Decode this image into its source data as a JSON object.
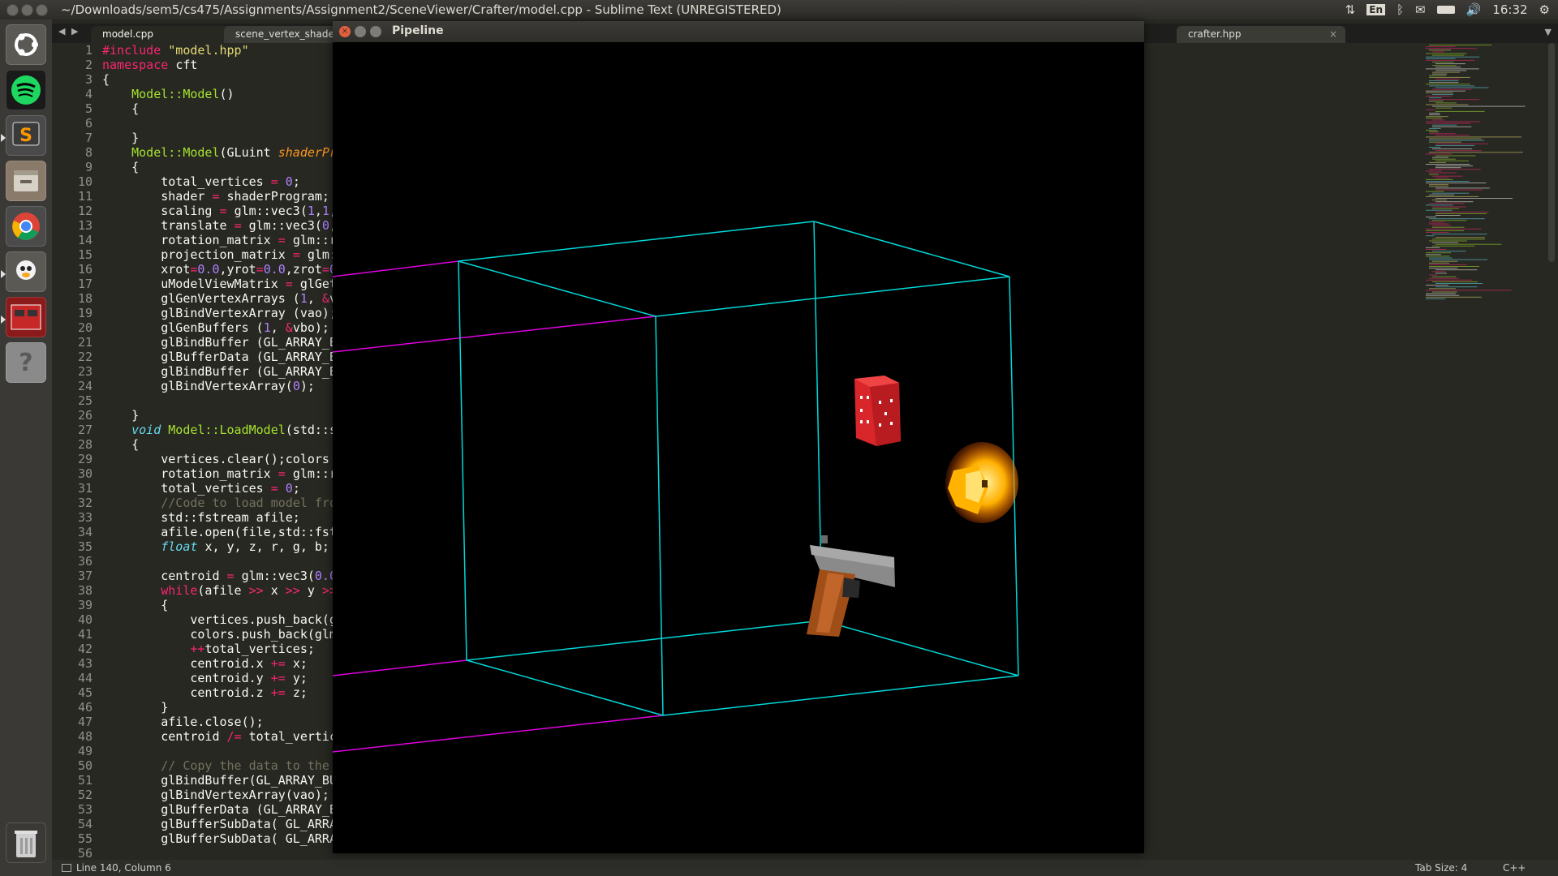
{
  "window": {
    "title": "~/Downloads/sem5/cs475/Assignments/Assignment2/SceneViewer/Crafter/model.cpp - Sublime Text (UNREGISTERED)"
  },
  "indicators": {
    "keyboard": "En",
    "clock": "16:32"
  },
  "launcher": {
    "apps": [
      {
        "name": "ubuntu-logo-icon"
      },
      {
        "name": "spotify-icon"
      },
      {
        "name": "sublime-text-icon"
      },
      {
        "name": "files-icon"
      },
      {
        "name": "chrome-icon"
      },
      {
        "name": "system-icon"
      },
      {
        "name": "pipeline-app-icon"
      },
      {
        "name": "unknown-app-icon"
      },
      {
        "name": "trash-icon"
      }
    ]
  },
  "tabs": [
    {
      "label": "model.cpp",
      "active": true
    },
    {
      "label": "scene_vertex_shader",
      "active": false
    },
    {
      "label": "crafter.hpp",
      "active": false
    }
  ],
  "editor": {
    "lines": [
      [
        [
          "kw",
          "#include "
        ],
        [
          "st",
          "\"model.hpp\""
        ]
      ],
      [
        [
          "kw",
          "namespace "
        ],
        [
          "",
          "cft"
        ]
      ],
      [
        [
          "",
          "{"
        ]
      ],
      [
        [
          "",
          "    "
        ],
        [
          "fn",
          "Model::Model"
        ],
        [
          "",
          "()"
        ]
      ],
      [
        [
          "",
          "    {"
        ]
      ],
      [
        [
          "",
          ""
        ]
      ],
      [
        [
          "",
          "    }"
        ]
      ],
      [
        [
          "",
          "    "
        ],
        [
          "fn",
          "Model::Model"
        ],
        [
          "",
          "(GLuint "
        ],
        [
          "pa",
          "shaderPr"
        ]
      ],
      [
        [
          "",
          "    {"
        ]
      ],
      [
        [
          "",
          "        total_vertices "
        ],
        [
          "kw",
          "= "
        ],
        [
          "nu",
          "0"
        ],
        [
          "",
          ";"
        ]
      ],
      [
        [
          "",
          "        shader "
        ],
        [
          "kw",
          "= "
        ],
        [
          "",
          "shaderProgram;"
        ]
      ],
      [
        [
          "",
          "        scaling "
        ],
        [
          "kw",
          "= "
        ],
        [
          "",
          "glm::vec3("
        ],
        [
          "nu",
          "1"
        ],
        [
          "",
          ","
        ],
        [
          "nu",
          "1"
        ],
        [
          "",
          ","
        ]
      ],
      [
        [
          "",
          "        translate "
        ],
        [
          "kw",
          "= "
        ],
        [
          "",
          "glm::vec3("
        ],
        [
          "nu",
          "0"
        ],
        [
          "",
          ","
        ]
      ],
      [
        [
          "",
          "        rotation_matrix "
        ],
        [
          "kw",
          "= "
        ],
        [
          "",
          "glm::r"
        ]
      ],
      [
        [
          "",
          "        projection_matrix "
        ],
        [
          "kw",
          "= "
        ],
        [
          "",
          "glm:"
        ]
      ],
      [
        [
          "",
          "        xrot"
        ],
        [
          "kw",
          "="
        ],
        [
          "nu",
          "0.0"
        ],
        [
          "",
          ",yrot"
        ],
        [
          "kw",
          "="
        ],
        [
          "nu",
          "0.0"
        ],
        [
          "",
          ",zrot"
        ],
        [
          "kw",
          "="
        ],
        [
          "nu",
          "0"
        ]
      ],
      [
        [
          "",
          "        uModelViewMatrix "
        ],
        [
          "kw",
          "= "
        ],
        [
          "",
          "glGet"
        ]
      ],
      [
        [
          "",
          "        glGenVertexArrays ("
        ],
        [
          "nu",
          "1"
        ],
        [
          "",
          ", "
        ],
        [
          "kw",
          "&"
        ],
        [
          "",
          "v"
        ]
      ],
      [
        [
          "",
          "        glBindVertexArray (vao);"
        ]
      ],
      [
        [
          "",
          "        glGenBuffers ("
        ],
        [
          "nu",
          "1"
        ],
        [
          "",
          ", "
        ],
        [
          "kw",
          "&"
        ],
        [
          "",
          "vbo);"
        ]
      ],
      [
        [
          "",
          "        glBindBuffer (GL_ARRAY_B"
        ]
      ],
      [
        [
          "",
          "        glBufferData (GL_ARRAY_B"
        ]
      ],
      [
        [
          "",
          "        glBindBuffer (GL_ARRAY_B"
        ]
      ],
      [
        [
          "",
          "        glBindVertexArray("
        ],
        [
          "nu",
          "0"
        ],
        [
          "",
          ");"
        ]
      ],
      [
        [
          "",
          ""
        ]
      ],
      [
        [
          "",
          "    }"
        ]
      ],
      [
        [
          "",
          "    "
        ],
        [
          "ty",
          "void "
        ],
        [
          "fn",
          "Model::LoadModel"
        ],
        [
          "",
          "(std::s"
        ]
      ],
      [
        [
          "",
          "    {"
        ]
      ],
      [
        [
          "",
          "        vertices.clear();colors"
        ]
      ],
      [
        [
          "",
          "        rotation_matrix "
        ],
        [
          "kw",
          "= "
        ],
        [
          "",
          "glm::r"
        ]
      ],
      [
        [
          "",
          "        total_vertices "
        ],
        [
          "kw",
          "= "
        ],
        [
          "nu",
          "0"
        ],
        [
          "",
          ";"
        ]
      ],
      [
        [
          "cm",
          "        //Code to load model fro"
        ]
      ],
      [
        [
          "",
          "        std::fstream afile;"
        ]
      ],
      [
        [
          "",
          "        afile.open(file,std::fst"
        ]
      ],
      [
        [
          "",
          "        "
        ],
        [
          "ty",
          "float "
        ],
        [
          "",
          "x, y, z, r, g, b;"
        ]
      ],
      [
        [
          "",
          ""
        ]
      ],
      [
        [
          "",
          "        centroid "
        ],
        [
          "kw",
          "= "
        ],
        [
          "",
          "glm::vec3("
        ],
        [
          "nu",
          "0.0"
        ]
      ],
      [
        [
          "",
          "        "
        ],
        [
          "kw",
          "while"
        ],
        [
          "",
          "(afile "
        ],
        [
          "kw",
          ">> "
        ],
        [
          "",
          "x "
        ],
        [
          "kw",
          ">> "
        ],
        [
          "",
          "y "
        ],
        [
          "kw",
          ">>"
        ]
      ],
      [
        [
          "",
          "        {"
        ]
      ],
      [
        [
          "",
          "            vertices.push_back(g"
        ]
      ],
      [
        [
          "",
          "            colors.push_back(glm"
        ]
      ],
      [
        [
          "",
          "            "
        ],
        [
          "kw",
          "++"
        ],
        [
          "",
          "total_vertices;"
        ]
      ],
      [
        [
          "",
          "            centroid.x "
        ],
        [
          "kw",
          "+= "
        ],
        [
          "",
          "x;"
        ]
      ],
      [
        [
          "",
          "            centroid.y "
        ],
        [
          "kw",
          "+= "
        ],
        [
          "",
          "y;"
        ]
      ],
      [
        [
          "",
          "            centroid.z "
        ],
        [
          "kw",
          "+= "
        ],
        [
          "",
          "z;"
        ]
      ],
      [
        [
          "",
          "        }"
        ]
      ],
      [
        [
          "",
          "        afile.close();"
        ]
      ],
      [
        [
          "",
          "        centroid "
        ],
        [
          "kw",
          "/= "
        ],
        [
          "",
          "total_vertic"
        ]
      ],
      [
        [
          "",
          ""
        ]
      ],
      [
        [
          "cm",
          "        // Copy the data to the"
        ]
      ],
      [
        [
          "",
          "        glBindBuffer(GL_ARRAY_BU"
        ]
      ],
      [
        [
          "",
          "        glBindVertexArray(vao);"
        ]
      ],
      [
        [
          "",
          "        glBufferData (GL_ARRAY_B"
        ]
      ],
      [
        [
          "",
          "        glBufferSubData( GL_ARRA"
        ]
      ],
      [
        [
          "",
          "        glBufferSubData( GL_ARRA"
        ]
      ],
      [
        [
          "",
          ""
        ]
      ]
    ]
  },
  "status": {
    "position": "Line 140, Column 6",
    "tab_size": "Tab Size: 4",
    "syntax": "C++"
  },
  "pipeline": {
    "title": "Pipeline",
    "frustum_color": "#00d8d8",
    "ray_color": "#e000e0"
  }
}
